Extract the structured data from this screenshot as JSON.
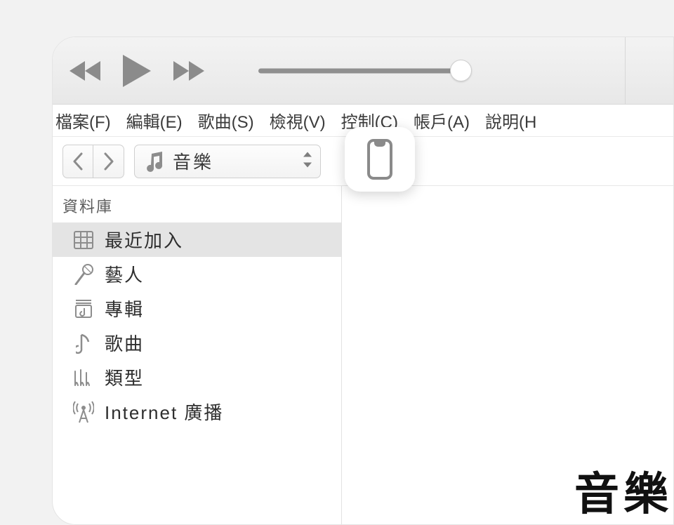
{
  "menu": {
    "file": "檔案(F)",
    "edit": "編輯(E)",
    "song": "歌曲(S)",
    "view": "檢視(V)",
    "control": "控制(C)",
    "account": "帳戶(A)",
    "help": "說明(H"
  },
  "nav": {
    "media_label": "音樂"
  },
  "sidebar": {
    "header": "資料庫",
    "items": [
      {
        "label": "最近加入"
      },
      {
        "label": "藝人"
      },
      {
        "label": "專輯"
      },
      {
        "label": "歌曲"
      },
      {
        "label": "類型"
      },
      {
        "label": "Internet 廣播"
      }
    ]
  },
  "content": {
    "title": "音樂"
  }
}
